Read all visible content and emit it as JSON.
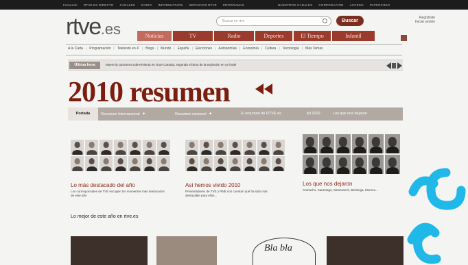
{
  "topbar": {
    "items": [
      "Fernando",
      "RTVE.ES DIRECTO",
      "CANALES",
      "RADIO",
      "INFORMATIVOS",
      "SERVICIOS RTVE",
      "PROGRAMAS"
    ],
    "right_items": [
      "NUESTROS CANALES",
      "CORPORACIÓN",
      "ACCESO",
      "PATROCINIO"
    ]
  },
  "header": {
    "logo": "rtve",
    "logo_suffix": ".es",
    "search_placeholder": "Buscar en rtve",
    "search_button": "Buscar",
    "register_line1": "Regístrate",
    "register_line2": "Iniciar sesión"
  },
  "mainnav": {
    "tabs": [
      "Noticias",
      "TV",
      "Radio",
      "Deportes",
      "El Tiempo",
      "Infantil"
    ]
  },
  "subnav": {
    "items": [
      "A la Carta",
      "Programación",
      "Teletexto en 4'",
      "Blogs",
      "Mundo",
      "España",
      "Elecciones",
      "Autonomías",
      "Economía",
      "Cultura",
      "Tecnología",
      "Más Temas"
    ]
  },
  "breaking": {
    "label": "Última hora",
    "text": "Muere la camarera sobrevivienta en Gran Canaria, segunda víctima de la explosión en un hotel"
  },
  "page": {
    "title": "2010 resumen"
  },
  "secnav": {
    "portada": "Portada",
    "items": [
      "Resumen Internacional",
      "Resumen nacional",
      "El resumen de RTVE.es",
      "Mi 2010",
      "Los que nos dejaron"
    ]
  },
  "columns": [
    {
      "title": "Lo más destacado del año",
      "desc": "Los corresponsales de TVE escogen los momentos más destacados de este año"
    },
    {
      "title": "Así hemos vivido 2010",
      "desc": "Presentadores de TVE y RNE nos cuentan qué ha sido más destacable para ellos..."
    },
    {
      "title": "Los que nos dejaron",
      "desc": "Camacho, Saramago, Samaranch, Berlanga, Moreno..."
    }
  ],
  "best": {
    "heading": "Lo mejor de este año en rtve.es",
    "bubble_text": "Bla bla"
  },
  "colors": {
    "brand": "#7b1e10",
    "nav": "#9b3b2b",
    "nav_active": "#c26b5d",
    "secnav": "#b3a9a3",
    "watermark": "#1fb8e8"
  }
}
